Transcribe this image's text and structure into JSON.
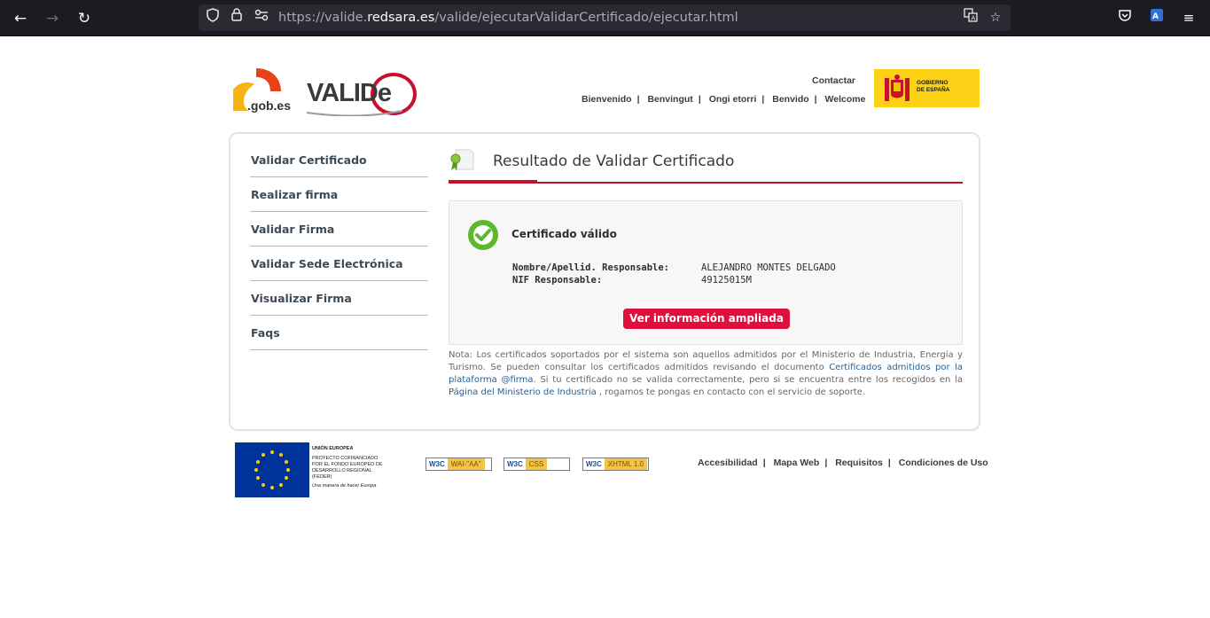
{
  "browser": {
    "url_prefix": "https://valide.",
    "url_domain": "redsara.es",
    "url_path": "/valide/ejecutarValidarCertificado/ejecutar.html"
  },
  "header": {
    "gob_logo_text": ".gob.es",
    "valide_logo_text": "VALIDe",
    "contact": "Contactar",
    "languages": [
      "Bienvenido",
      "Benvingut",
      "Ongi etorri",
      "Benvido",
      "Welcome"
    ],
    "gobierno_text_1": "GOBIERNO",
    "gobierno_text_2": "DE ESPAÑA"
  },
  "sidebar": {
    "items": [
      {
        "label": "Validar Certificado"
      },
      {
        "label": "Realizar firma"
      },
      {
        "label": "Validar Firma"
      },
      {
        "label": "Validar Sede Electrónica"
      },
      {
        "label": "Visualizar Firma"
      },
      {
        "label": "Faqs"
      }
    ]
  },
  "content": {
    "title": "Resultado de Validar Certificado",
    "status": "Certificado válido",
    "fields": [
      {
        "label": "Nombre/Apellid. Responsable:",
        "value": "ALEJANDRO MONTES DELGADO"
      },
      {
        "label": "NIF Responsable:",
        "value": "49125015M"
      }
    ],
    "more_button": "Ver información ampliada",
    "note_part1": "Nota: Los certificados soportados por el sistema son aquellos admitidos por el Ministerio de Industria, Energía y Turismo. Se pueden consultar los certificados admitidos revisando el documento ",
    "note_link1": "Certificados admitidos por la plataforma @firma",
    "note_part2": ". Si tu certificado no se valida correctamente, pero si se encuentra entre los recogidos en la ",
    "note_link2": "Página del Ministerio de Industria",
    "note_part3": " , rogamos te pongas en contacto con el servicio de soporte."
  },
  "footer": {
    "eu_line1": "UNIÓN EUROPEA",
    "eu_line2": "PROYECTO COFINANCIADO",
    "eu_line3": "POR EL FONDO EUROPEO DE",
    "eu_line4": "DESARROLLO REGIONAL",
    "eu_line5": "(FEDER)",
    "eu_line6": "Una manera de hacer Europa",
    "badges": [
      {
        "w": "W3C",
        "label": "WAI-\"AA\""
      },
      {
        "w": "W3C",
        "label": "CSS"
      },
      {
        "w": "W3C",
        "label": "XHTML 1.0"
      }
    ],
    "links": [
      "Accesibilidad",
      "Mapa Web",
      "Requisitos",
      "Condiciones de Uso"
    ]
  },
  "colors": {
    "accent_red": "#c8102e",
    "button_red": "#e0103c",
    "check_green": "#5cb82c",
    "link_blue": "#2b5f8e"
  }
}
